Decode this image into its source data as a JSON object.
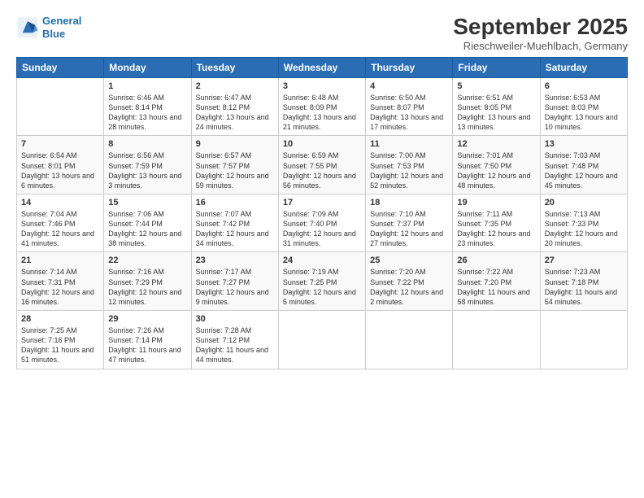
{
  "header": {
    "logo_line1": "General",
    "logo_line2": "Blue",
    "month": "September 2025",
    "location": "Rieschweiler-Muehlbach, Germany"
  },
  "days_of_week": [
    "Sunday",
    "Monday",
    "Tuesday",
    "Wednesday",
    "Thursday",
    "Friday",
    "Saturday"
  ],
  "weeks": [
    [
      {
        "day": "",
        "text": ""
      },
      {
        "day": "1",
        "text": "Sunrise: 6:46 AM\nSunset: 8:14 PM\nDaylight: 13 hours and 28 minutes."
      },
      {
        "day": "2",
        "text": "Sunrise: 6:47 AM\nSunset: 8:12 PM\nDaylight: 13 hours and 24 minutes."
      },
      {
        "day": "3",
        "text": "Sunrise: 6:48 AM\nSunset: 8:09 PM\nDaylight: 13 hours and 21 minutes."
      },
      {
        "day": "4",
        "text": "Sunrise: 6:50 AM\nSunset: 8:07 PM\nDaylight: 13 hours and 17 minutes."
      },
      {
        "day": "5",
        "text": "Sunrise: 6:51 AM\nSunset: 8:05 PM\nDaylight: 13 hours and 13 minutes."
      },
      {
        "day": "6",
        "text": "Sunrise: 6:53 AM\nSunset: 8:03 PM\nDaylight: 13 hours and 10 minutes."
      }
    ],
    [
      {
        "day": "7",
        "text": "Sunrise: 6:54 AM\nSunset: 8:01 PM\nDaylight: 13 hours and 6 minutes."
      },
      {
        "day": "8",
        "text": "Sunrise: 6:56 AM\nSunset: 7:59 PM\nDaylight: 13 hours and 3 minutes."
      },
      {
        "day": "9",
        "text": "Sunrise: 6:57 AM\nSunset: 7:57 PM\nDaylight: 12 hours and 59 minutes."
      },
      {
        "day": "10",
        "text": "Sunrise: 6:59 AM\nSunset: 7:55 PM\nDaylight: 12 hours and 56 minutes."
      },
      {
        "day": "11",
        "text": "Sunrise: 7:00 AM\nSunset: 7:53 PM\nDaylight: 12 hours and 52 minutes."
      },
      {
        "day": "12",
        "text": "Sunrise: 7:01 AM\nSunset: 7:50 PM\nDaylight: 12 hours and 48 minutes."
      },
      {
        "day": "13",
        "text": "Sunrise: 7:03 AM\nSunset: 7:48 PM\nDaylight: 12 hours and 45 minutes."
      }
    ],
    [
      {
        "day": "14",
        "text": "Sunrise: 7:04 AM\nSunset: 7:46 PM\nDaylight: 12 hours and 41 minutes."
      },
      {
        "day": "15",
        "text": "Sunrise: 7:06 AM\nSunset: 7:44 PM\nDaylight: 12 hours and 38 minutes."
      },
      {
        "day": "16",
        "text": "Sunrise: 7:07 AM\nSunset: 7:42 PM\nDaylight: 12 hours and 34 minutes."
      },
      {
        "day": "17",
        "text": "Sunrise: 7:09 AM\nSunset: 7:40 PM\nDaylight: 12 hours and 31 minutes."
      },
      {
        "day": "18",
        "text": "Sunrise: 7:10 AM\nSunset: 7:37 PM\nDaylight: 12 hours and 27 minutes."
      },
      {
        "day": "19",
        "text": "Sunrise: 7:11 AM\nSunset: 7:35 PM\nDaylight: 12 hours and 23 minutes."
      },
      {
        "day": "20",
        "text": "Sunrise: 7:13 AM\nSunset: 7:33 PM\nDaylight: 12 hours and 20 minutes."
      }
    ],
    [
      {
        "day": "21",
        "text": "Sunrise: 7:14 AM\nSunset: 7:31 PM\nDaylight: 12 hours and 16 minutes."
      },
      {
        "day": "22",
        "text": "Sunrise: 7:16 AM\nSunset: 7:29 PM\nDaylight: 12 hours and 12 minutes."
      },
      {
        "day": "23",
        "text": "Sunrise: 7:17 AM\nSunset: 7:27 PM\nDaylight: 12 hours and 9 minutes."
      },
      {
        "day": "24",
        "text": "Sunrise: 7:19 AM\nSunset: 7:25 PM\nDaylight: 12 hours and 5 minutes."
      },
      {
        "day": "25",
        "text": "Sunrise: 7:20 AM\nSunset: 7:22 PM\nDaylight: 12 hours and 2 minutes."
      },
      {
        "day": "26",
        "text": "Sunrise: 7:22 AM\nSunset: 7:20 PM\nDaylight: 11 hours and 58 minutes."
      },
      {
        "day": "27",
        "text": "Sunrise: 7:23 AM\nSunset: 7:18 PM\nDaylight: 11 hours and 54 minutes."
      }
    ],
    [
      {
        "day": "28",
        "text": "Sunrise: 7:25 AM\nSunset: 7:16 PM\nDaylight: 11 hours and 51 minutes."
      },
      {
        "day": "29",
        "text": "Sunrise: 7:26 AM\nSunset: 7:14 PM\nDaylight: 11 hours and 47 minutes."
      },
      {
        "day": "30",
        "text": "Sunrise: 7:28 AM\nSunset: 7:12 PM\nDaylight: 11 hours and 44 minutes."
      },
      {
        "day": "",
        "text": ""
      },
      {
        "day": "",
        "text": ""
      },
      {
        "day": "",
        "text": ""
      },
      {
        "day": "",
        "text": ""
      }
    ]
  ]
}
